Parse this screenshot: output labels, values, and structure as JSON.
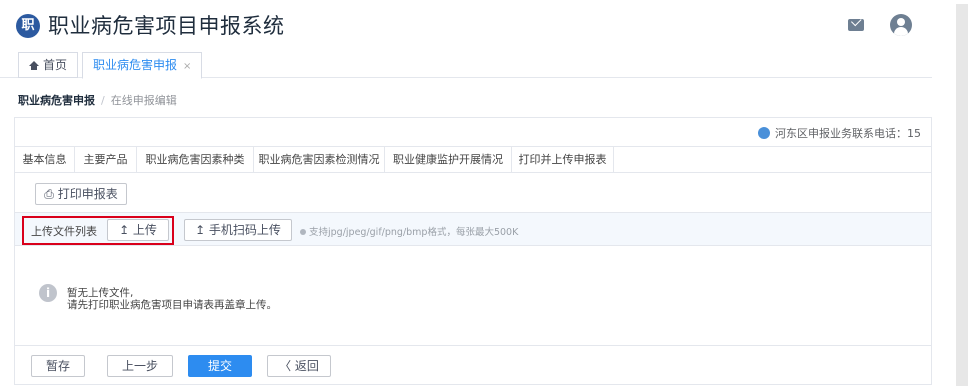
{
  "header": {
    "logo_glyph": "职",
    "title": "职业病危害项目申报系统"
  },
  "tabs": [
    {
      "label": "首页"
    },
    {
      "label": "职业病危害申报",
      "close": "×"
    }
  ],
  "breadcrumb": {
    "current": "职业病危害申报",
    "separator": "/",
    "sub": "在线申报编辑"
  },
  "notice": "河东区申报业务联系电话：15",
  "steps": [
    "基本信息",
    "主要产品",
    "职业病危害因素种类",
    "职业病危害因素检测情况",
    "职业健康监护开展情况",
    "打印并上传申报表"
  ],
  "print_button": "⎙ 打印申报表",
  "upload": {
    "label": "上传文件列表",
    "upload_button": "↥ 上传",
    "mobile_button": "↥ 手机扫码上传",
    "hint": "支持jpg/jpeg/gif/png/bmp格式，每张最大500K"
  },
  "empty": {
    "line1": "暂无上传文件,",
    "line2": "请先打印职业病危害项目申请表再盖章上传。"
  },
  "footer": {
    "save": "暂存",
    "prev": "上一步",
    "submit": "提交",
    "back": "〈 返回"
  },
  "colors": {
    "accent": "#2d8cf0",
    "highlight_border": "#d9001b"
  }
}
